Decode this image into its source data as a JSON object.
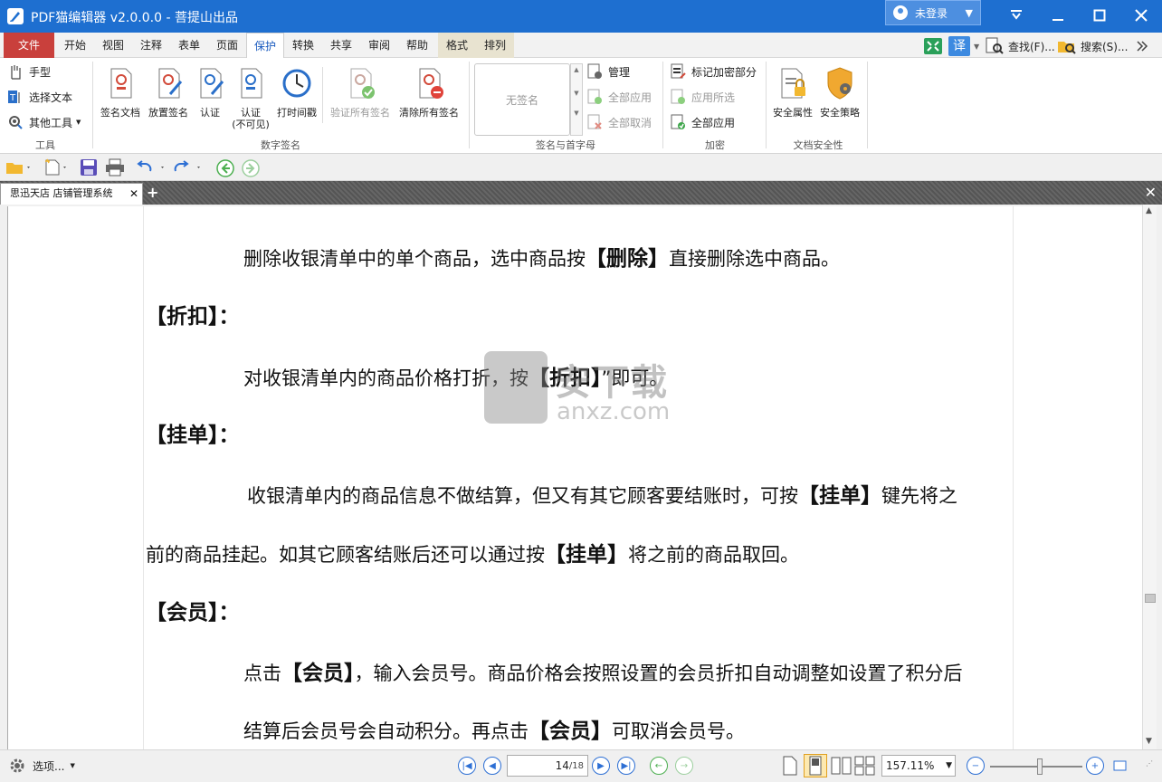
{
  "titlebar": {
    "title": "PDF猫编辑器 v2.0.0.0 - 菩提山出品",
    "login_label": "未登录"
  },
  "menubar": {
    "file": "文件",
    "tabs": [
      "开始",
      "视图",
      "注释",
      "表单",
      "页面",
      "保护",
      "转换",
      "共享",
      "审阅",
      "帮助"
    ],
    "context_tabs": [
      "格式",
      "排列"
    ],
    "active_tab": "保护",
    "translate_label": "译",
    "find_label": "查找(F)...",
    "search_label": "搜索(S)..."
  },
  "ribbon": {
    "tools": {
      "hand": "手型",
      "select_text": "选择文本",
      "other_tools": "其他工具",
      "group_label": "工具"
    },
    "digital_signature": {
      "sign_doc": "签名文档",
      "place_sig": "放置签名",
      "certify": "认证",
      "certify_invisible_1": "认证",
      "certify_invisible_2": "(不可见)",
      "timestamp": "打时间戳",
      "verify_all": "验证所有签名",
      "clear_all": "清除所有签名",
      "group_label": "数字签名"
    },
    "initials": {
      "no_signature": "无签名",
      "manage": "管理",
      "apply_all": "全部应用",
      "cancel_all": "全部取消",
      "group_label": "签名与首字母"
    },
    "redaction": {
      "mark_redact": "标记加密部分",
      "apply_selected": "应用所选",
      "apply_all": "全部应用",
      "group_label": "加密"
    },
    "security": {
      "properties": "安全属性",
      "policy": "安全策略",
      "group_label": "文档安全性"
    }
  },
  "doc_tab": {
    "title": "思迅天店 店铺管理系统"
  },
  "document": {
    "p1_a": "删除收银清单中的单个商品，选中商品按",
    "p1_b": "【删除】",
    "p1_c": "直接删除选中商品。",
    "h1": "【折扣】：",
    "p2_a": "对收银清单内的商品价格打折，按",
    "p2_b": "【折扣】",
    "p2_c": "”即可。",
    "h2": "【挂单】：",
    "p3_a": "收银清单内的商品信息不做结算，但又有其它顾客要结账时，可按",
    "p3_b": "【挂单】",
    "p3_c": "键先将之",
    "p4_a": "前的商品挂起。如其它顾客结账后还可以通过按",
    "p4_b": "【挂单】",
    "p4_c": "将之前的商品取回。",
    "h3": "【会员】：",
    "p5_a": "点击",
    "p5_b": "【会员】",
    "p5_c": "，输入会员号。商品价格会按照设置的会员折扣自动调整如设置了积分后",
    "p6_a": "结算后会员号会自动积分。再点击",
    "p6_b": "【会员】",
    "p6_c": "可取消会员号。",
    "watermark_1": "安下载",
    "watermark_2": "anxz.com"
  },
  "statusbar": {
    "options": "选项...",
    "current_page": "14",
    "total_pages": "/18",
    "zoom": "157.11%"
  },
  "colors": {
    "titlebar": "#1e6fd0",
    "file_menu": "#c9403c",
    "accent": "#2d6fd4"
  }
}
